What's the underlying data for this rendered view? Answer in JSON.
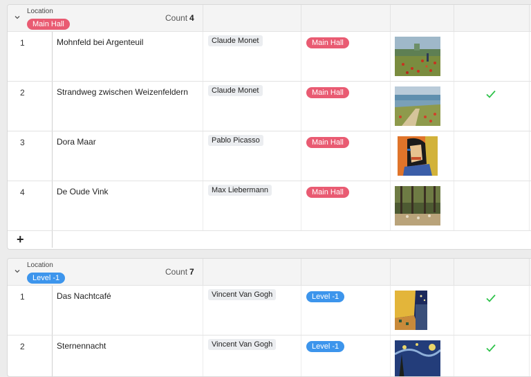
{
  "groups": [
    {
      "location_label": "Location",
      "location_value": "Main Hall",
      "location_color": "#e95b72",
      "count_label": "Count",
      "count_value": "4",
      "rows": [
        {
          "num": "1",
          "title": "Mohnfeld bei Argenteuil",
          "artist": "Claude Monet",
          "location": "Main Hall",
          "checked": false
        },
        {
          "num": "2",
          "title": "Strandweg zwischen Weizenfeldern",
          "artist": "Claude Monet",
          "location": "Main Hall",
          "checked": true
        },
        {
          "num": "3",
          "title": "Dora Maar",
          "artist": "Pablo Picasso",
          "location": "Main Hall",
          "checked": false
        },
        {
          "num": "4",
          "title": "De Oude Vink",
          "artist": "Max Liebermann",
          "location": "Main Hall",
          "checked": false
        }
      ],
      "add_label": "+"
    },
    {
      "location_label": "Location",
      "location_value": "Level -1",
      "location_color": "#3d95ec",
      "count_label": "Count",
      "count_value": "7",
      "rows": [
        {
          "num": "1",
          "title": "Das Nachtcafé",
          "artist": "Vincent Van Gogh",
          "location": "Level -1",
          "checked": true
        },
        {
          "num": "2",
          "title": "Sternennacht",
          "artist": "Vincent Van Gogh",
          "location": "Level -1",
          "checked": true
        }
      ]
    }
  ],
  "icons": {
    "collapse": "chevron-down-icon",
    "check": "checkmark-icon",
    "add": "plus-icon"
  },
  "colors": {
    "check_green": "#2ec24a",
    "main_hall": "#e95b72",
    "level_minus_1": "#3d95ec"
  }
}
